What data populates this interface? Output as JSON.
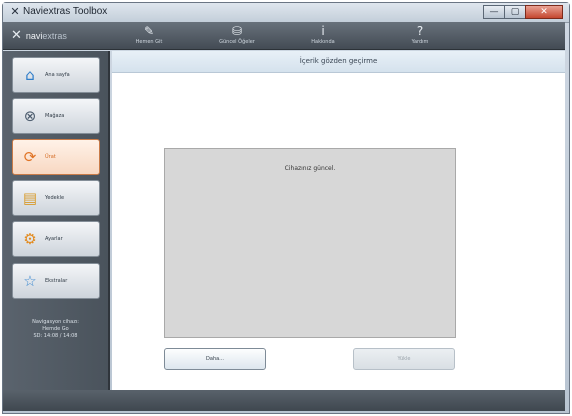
{
  "window": {
    "title": "Naviextras Toolbox",
    "app_glyph": "✕",
    "controls": [
      "—",
      "▢",
      "✕"
    ]
  },
  "toolbar": {
    "brand_a": "navi",
    "brand_b": "extras",
    "items": [
      {
        "label": "Hemen Git",
        "icon": "✎"
      },
      {
        "label": "Güncel Öğeler",
        "icon": "⛁"
      },
      {
        "label": "Hakkında",
        "icon": "i"
      },
      {
        "label": "Yardım",
        "icon": "?"
      }
    ]
  },
  "sidebar": {
    "items": [
      {
        "label": "Ana sayfa",
        "icon": "⌂"
      },
      {
        "label": "Mağaza",
        "icon": "⊗"
      },
      {
        "label": "Ürat",
        "icon": "⟳"
      },
      {
        "label": "Yedekle",
        "icon": "▤"
      },
      {
        "label": "Ayarlar",
        "icon": "⚙"
      },
      {
        "label": "Ekstralar",
        "icon": "☆"
      }
    ],
    "status_lines": [
      "Navigasyon cihazı:",
      "Hemde Go",
      "SD: 14:08 / 14:08"
    ]
  },
  "main": {
    "title": "İçerik gözden geçirme",
    "message": "Cihazınız güncel.",
    "more_button": "Daha...",
    "install_button": "Yükle"
  },
  "colors": {
    "active_accent": "#d46a22",
    "toolbar_bg": "#4f5760",
    "content_box_bg": "#d7d7d7"
  }
}
